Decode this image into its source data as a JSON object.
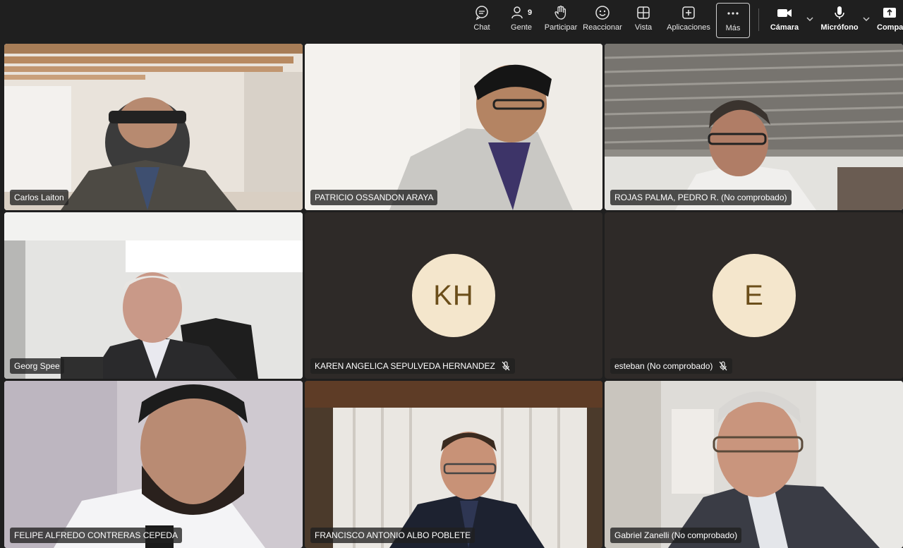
{
  "toolbar": {
    "chat": "Chat",
    "people": "Gente",
    "people_count": "9",
    "raise": "Participar",
    "react": "Reaccionar",
    "view": "Vista",
    "apps": "Aplicaciones",
    "more": "Más",
    "camera": "Cámara",
    "mic": "Micrófono",
    "share": "Compa"
  },
  "participants": [
    {
      "name": "Carlos Laiton"
    },
    {
      "name": "PATRICIO OSSANDON ARAYA"
    },
    {
      "name": "ROJAS PALMA, PEDRO R. (No comprobado)"
    },
    {
      "name": "Georg Spee"
    },
    {
      "name": "KAREN ANGELICA SEPULVEDA HERNANDEZ",
      "initials": "KH"
    },
    {
      "name": "esteban (No comprobado)",
      "initials": "E"
    },
    {
      "name": "FELIPE ALFREDO CONTRERAS CEPEDA"
    },
    {
      "name": "FRANCISCO ANTONIO ALBO POBLETE"
    },
    {
      "name": "Gabriel Zanelli (No comprobado)"
    }
  ],
  "colors": {
    "background": "#1f1f1f",
    "active_speaker_border": "#8b8ff0",
    "avatar_bg": "#f4e6cc",
    "avatar_text": "#6b4e1a"
  }
}
